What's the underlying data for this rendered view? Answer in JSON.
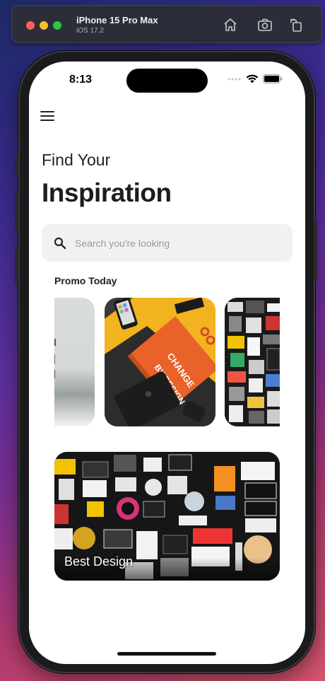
{
  "simulator": {
    "device_name": "iPhone 15 Pro Max",
    "os_version": "iOS 17.2",
    "icons": [
      "home-icon",
      "screenshot-icon",
      "rotate-icon"
    ]
  },
  "status_bar": {
    "time": "8:13",
    "icons": [
      "signal-dots-icon",
      "wifi-icon",
      "battery-icon"
    ]
  },
  "header": {
    "menu_icon": "hamburger-menu-icon",
    "subtitle": "Find Your",
    "title": "Inspiration"
  },
  "search": {
    "placeholder": "Search you're looking",
    "value": "",
    "icon": "search-icon"
  },
  "promo": {
    "title": "Promo Today",
    "cards": [
      {
        "name": "promo-card-partial-left",
        "image": "grey-gradient-photo"
      },
      {
        "name": "promo-card-change-by-design",
        "image": "orange-book-change-by-design"
      },
      {
        "name": "promo-card-stickers",
        "image": "sticker-wall-photo"
      }
    ]
  },
  "featured": {
    "label": "Best Design",
    "image": "sticker-wall-photo"
  },
  "colors": {
    "accent_orange": "#e8622a",
    "card_yellow": "#f2b41e",
    "search_bg": "#f1f1f2",
    "text_dark": "#1d1d1d"
  }
}
